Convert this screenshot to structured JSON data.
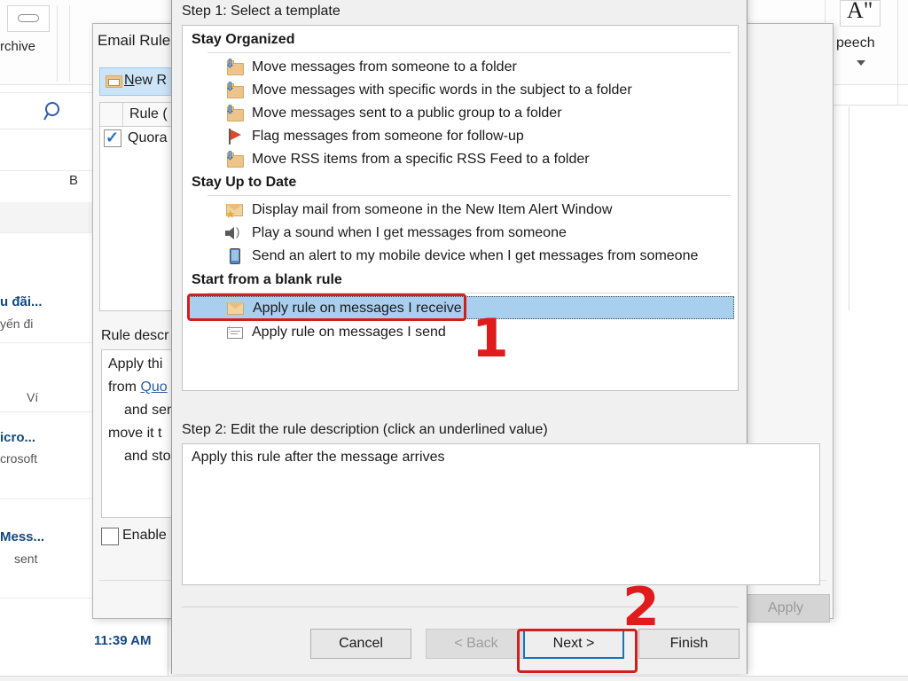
{
  "background": {
    "ribbon": {
      "archive_label": "rchive",
      "speech_label": "peech",
      "speech_glyph": "A\"",
      "caret": "chevron-down-icon"
    },
    "left_pane": {
      "search_icon": "search-icon",
      "b_label": "B",
      "messages": [
        {
          "title": "u đãi...",
          "sub": "yến đi"
        },
        {
          "title": "",
          "sub": "Ví"
        },
        {
          "title": "icro...",
          "sub": "crosoft"
        },
        {
          "title": "Mess...",
          "sub": "sent"
        }
      ],
      "time": "11:39 AM"
    },
    "right_panel": {
      "tool_icon": "tools-icon",
      "scroll_up_icon": "chevron-up-icon",
      "scroll_down_icon": "chevron-down-icon"
    }
  },
  "rules_dialog": {
    "title": "Email Rules",
    "new_rule_button": "New R",
    "new_rule_underline": "N",
    "column_header": "Rule (",
    "row_label": "Quora",
    "row_checked": true,
    "rule_description_label": "Rule descr",
    "rule_description_lines": [
      "Apply thi",
      "from Quo",
      "and sen",
      "move it t",
      "and sto"
    ],
    "enable_checkbox_label": "Enable",
    "apply_button": "Apply"
  },
  "wizard": {
    "step1_label": "Step 1: Select a template",
    "step2_label": "Step 2: Edit the rule description (click an underlined value)",
    "groups": [
      {
        "heading": "Stay Organized",
        "items": [
          {
            "label": "Move messages from someone to a folder",
            "icon": "folder-move-icon"
          },
          {
            "label": "Move messages with specific words in the subject to a folder",
            "icon": "folder-move-icon"
          },
          {
            "label": "Move messages sent to a public group to a folder",
            "icon": "folder-move-icon"
          },
          {
            "label": "Flag messages from someone for follow-up",
            "icon": "flag-icon"
          },
          {
            "label": "Move RSS items from a specific RSS Feed to a folder",
            "icon": "folder-move-icon"
          }
        ]
      },
      {
        "heading": "Stay Up to Date",
        "items": [
          {
            "label": "Display mail from someone in the New Item Alert Window",
            "icon": "envelope-star-icon"
          },
          {
            "label": "Play a sound when I get messages from someone",
            "icon": "speaker-icon"
          },
          {
            "label": "Send an alert to my mobile device when I get messages from someone",
            "icon": "mobile-device-icon"
          }
        ]
      },
      {
        "heading": "Start from a blank rule",
        "items": [
          {
            "label": "Apply rule on messages I receive",
            "icon": "envelope-incoming-icon",
            "selected": true
          },
          {
            "label": "Apply rule on messages I send",
            "icon": "envelope-outgoing-icon",
            "selected": false
          }
        ]
      }
    ],
    "description_text": "Apply this rule after the message arrives",
    "buttons": {
      "cancel": "Cancel",
      "back": "< Back",
      "next": "Next >",
      "finish": "Finish"
    }
  },
  "annotations": {
    "step_one": "1",
    "step_two": "2",
    "highlight_color": "#d11f1f"
  },
  "colors": {
    "selection_blue": "#a9cfee",
    "accent_blue": "#1573c7",
    "annotation_red": "#d11f1f",
    "link_blue": "#2a5db0"
  }
}
